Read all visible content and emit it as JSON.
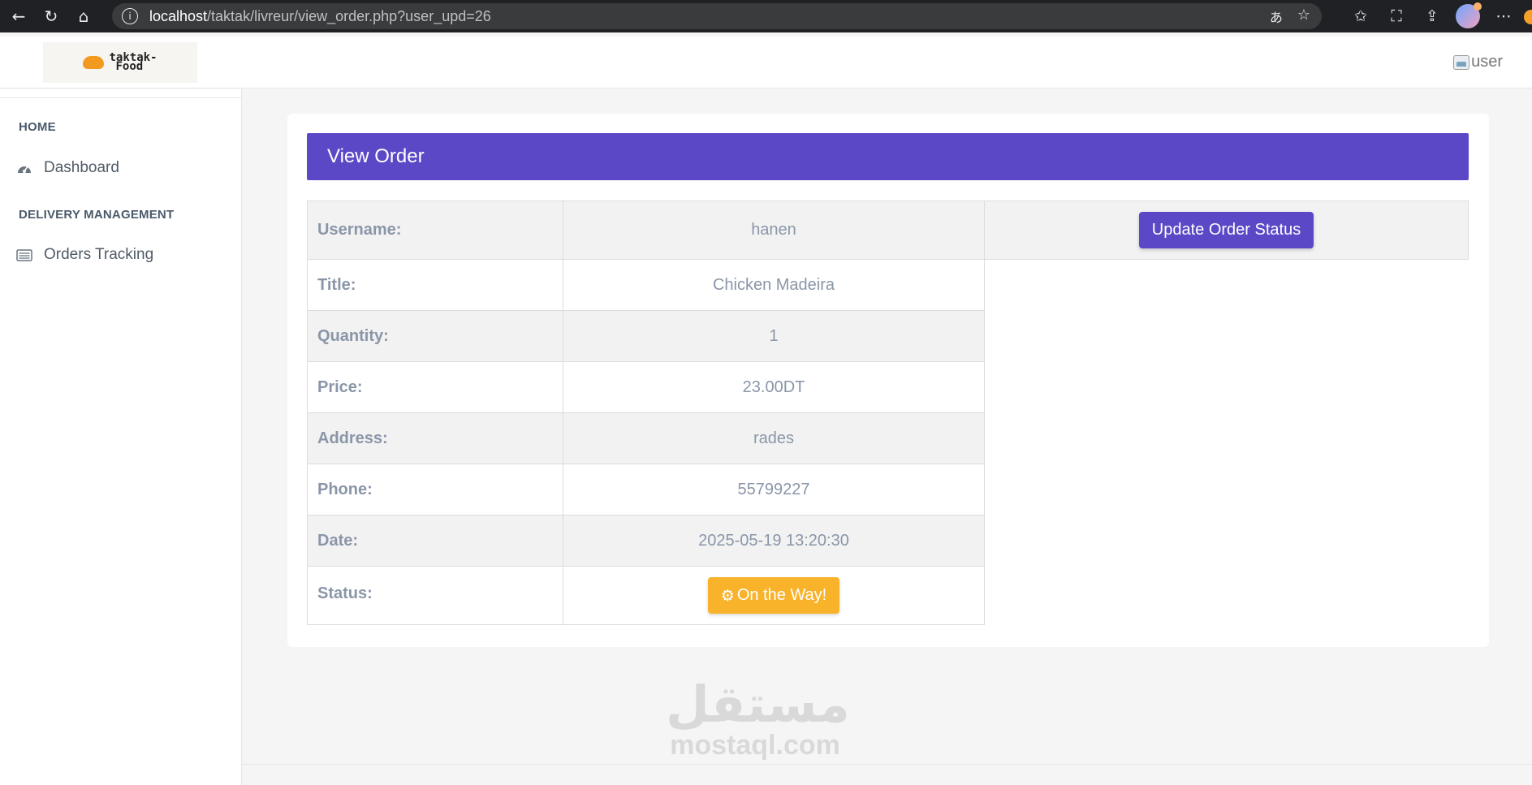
{
  "browser": {
    "url_host": "localhost",
    "url_path": "/taktak/livreur/view_order.php?user_upd=26"
  },
  "header": {
    "logo_line1": "taktak-",
    "logo_line2": "Food",
    "user_alt": "user"
  },
  "sidebar": {
    "heading_home": "HOME",
    "dashboard_label": "Dashboard",
    "heading_delivery": "DELIVERY MANAGEMENT",
    "orders_label": "Orders Tracking"
  },
  "card": {
    "title": "View Order",
    "update_button": "Update Order Status",
    "rows": [
      {
        "label": "Username:",
        "value": "hanen"
      },
      {
        "label": "Title:",
        "value": "Chicken Madeira"
      },
      {
        "label": "Quantity:",
        "value": "1"
      },
      {
        "label": "Price:",
        "value": "23.00DT"
      },
      {
        "label": "Address:",
        "value": "rades"
      },
      {
        "label": "Phone:",
        "value": "55799227"
      },
      {
        "label": "Date:",
        "value": "2025-05-19 13:20:30"
      },
      {
        "label": "Status:",
        "value": "On the Way!"
      }
    ]
  },
  "watermark": {
    "arabic": "مستقل",
    "latin": "mostaql.com"
  },
  "colors": {
    "primary": "#5b48c6",
    "status_warning": "#f9b32b"
  },
  "icons": [
    "back-icon",
    "reload-icon",
    "home-icon",
    "info-icon",
    "translate-icon",
    "star-icon",
    "favorites-icon",
    "screenshot-icon",
    "share-icon",
    "more-icon",
    "dashboard-icon",
    "list-icon",
    "gear-icon"
  ]
}
